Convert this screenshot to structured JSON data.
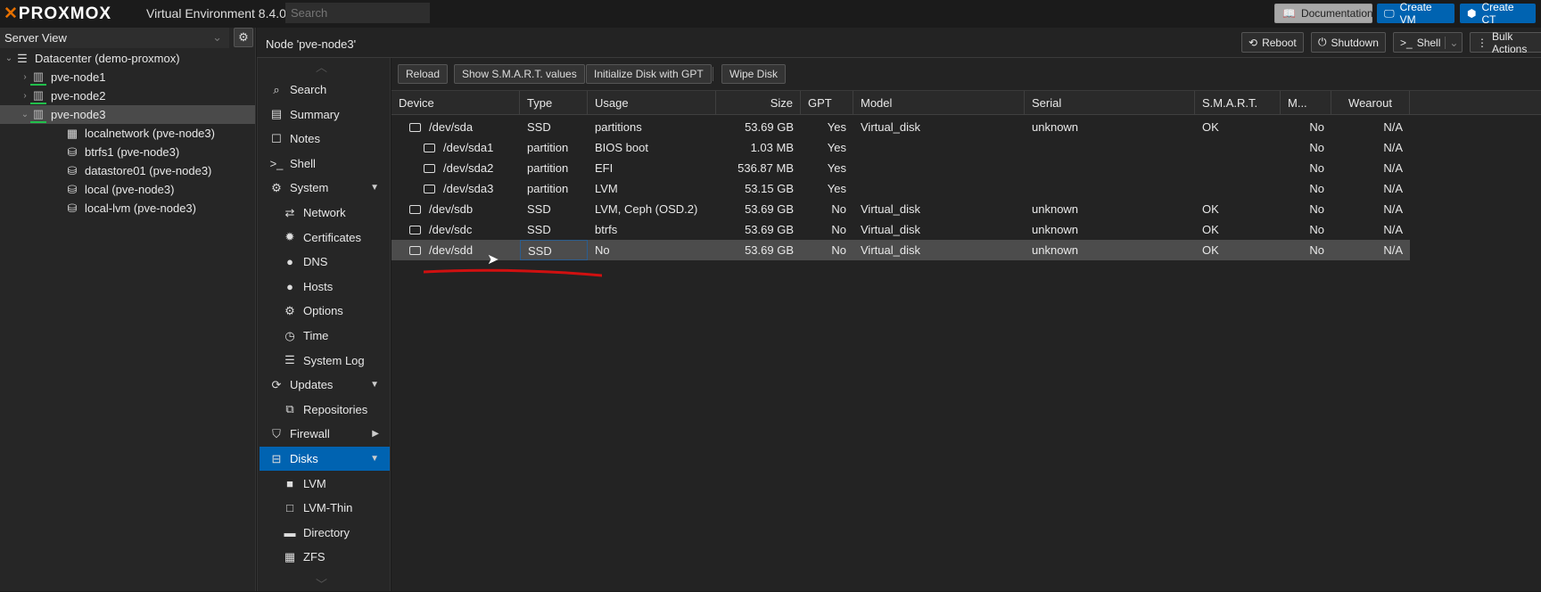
{
  "topbar": {
    "brand": "PROXMOX",
    "version": "Virtual Environment 8.4.0",
    "search_placeholder": "Search",
    "documentation": "Documentation",
    "create_vm": "Create VM",
    "create_ct": "Create CT"
  },
  "tree": {
    "view": "Server View",
    "items": [
      {
        "label": "Datacenter (demo-proxmox)",
        "icon": "datacenter-icon",
        "level": 0,
        "expander": "⌄"
      },
      {
        "label": "pve-node1",
        "icon": "node-online-icon",
        "level": 1,
        "expander": "›"
      },
      {
        "label": "pve-node2",
        "icon": "node-online-icon",
        "level": 1,
        "expander": "›"
      },
      {
        "label": "pve-node3",
        "icon": "node-online-icon",
        "level": 1,
        "expander": "⌄",
        "selected": true
      },
      {
        "label": "localnetwork (pve-node3)",
        "icon": "network-zone-icon",
        "level": 2
      },
      {
        "label": "btrfs1 (pve-node3)",
        "icon": "storage-icon",
        "level": 2
      },
      {
        "label": "datastore01 (pve-node3)",
        "icon": "storage-icon",
        "level": 2
      },
      {
        "label": "local (pve-node3)",
        "icon": "storage-icon",
        "level": 2
      },
      {
        "label": "local-lvm (pve-node3)",
        "icon": "storage-icon",
        "level": 2
      }
    ]
  },
  "header": {
    "title": "Node 'pve-node3'",
    "reboot": "Reboot",
    "shutdown": "Shutdown",
    "shell": "Shell",
    "bulk": "Bulk Actions"
  },
  "nav": [
    {
      "label": "Search",
      "icon": "⌕",
      "type": "main"
    },
    {
      "label": "Summary",
      "icon": "▤",
      "type": "main"
    },
    {
      "label": "Notes",
      "icon": "☐",
      "type": "main"
    },
    {
      "label": "Shell",
      "icon": ">_",
      "type": "main"
    },
    {
      "label": "System",
      "icon": "⚙",
      "type": "main",
      "arrow": "▼"
    },
    {
      "label": "Network",
      "icon": "⇄",
      "type": "sub"
    },
    {
      "label": "Certificates",
      "icon": "✹",
      "type": "sub"
    },
    {
      "label": "DNS",
      "icon": "●",
      "type": "sub"
    },
    {
      "label": "Hosts",
      "icon": "●",
      "type": "sub"
    },
    {
      "label": "Options",
      "icon": "⚙",
      "type": "sub"
    },
    {
      "label": "Time",
      "icon": "◷",
      "type": "sub"
    },
    {
      "label": "System Log",
      "icon": "☰",
      "type": "sub"
    },
    {
      "label": "Updates",
      "icon": "⟳",
      "type": "main",
      "arrow": "▼"
    },
    {
      "label": "Repositories",
      "icon": "⧉",
      "type": "sub"
    },
    {
      "label": "Firewall",
      "icon": "⛉",
      "type": "main",
      "arrow": "▶"
    },
    {
      "label": "Disks",
      "icon": "⊟",
      "type": "main",
      "arrow": "▼",
      "selected": true
    },
    {
      "label": "LVM",
      "icon": "■",
      "type": "sub"
    },
    {
      "label": "LVM-Thin",
      "icon": "□",
      "type": "sub"
    },
    {
      "label": "Directory",
      "icon": "▬",
      "type": "sub"
    },
    {
      "label": "ZFS",
      "icon": "▦",
      "type": "sub"
    }
  ],
  "toolbar": {
    "reload": "Reload",
    "smart": "Show S.M.A.R.T. values",
    "init_gpt": "Initialize Disk with GPT",
    "wipe": "Wipe Disk"
  },
  "columns": [
    "Device",
    "Type",
    "Usage",
    "Size",
    "GPT",
    "Model",
    "Serial",
    "S.M.A.R.T.",
    "M...",
    "Wearout"
  ],
  "rows": [
    [
      "/dev/sda",
      "SSD",
      "partitions",
      "53.69 GB",
      "Yes",
      "Virtual_disk",
      "unknown",
      "OK",
      "No",
      "N/A"
    ],
    [
      "/dev/sda1",
      "partition",
      "BIOS boot",
      "1.03 MB",
      "Yes",
      "",
      "",
      "",
      "No",
      "N/A"
    ],
    [
      "/dev/sda2",
      "partition",
      "EFI",
      "536.87 MB",
      "Yes",
      "",
      "",
      "",
      "No",
      "N/A"
    ],
    [
      "/dev/sda3",
      "partition",
      "LVM",
      "53.15 GB",
      "Yes",
      "",
      "",
      "",
      "No",
      "N/A"
    ],
    [
      "/dev/sdb",
      "SSD",
      "LVM, Ceph (OSD.2)",
      "53.69 GB",
      "No",
      "Virtual_disk",
      "unknown",
      "OK",
      "No",
      "N/A"
    ],
    [
      "/dev/sdc",
      "SSD",
      "btrfs",
      "53.69 GB",
      "No",
      "Virtual_disk",
      "unknown",
      "OK",
      "No",
      "N/A"
    ],
    [
      "/dev/sdd",
      "SSD",
      "No",
      "53.69 GB",
      "No",
      "Virtual_disk",
      "unknown",
      "OK",
      "No",
      "N/A"
    ]
  ],
  "selected_row": 6,
  "colors": {
    "accent": "#0063b1",
    "brand": "#e57000",
    "annotation": "#d01010"
  }
}
